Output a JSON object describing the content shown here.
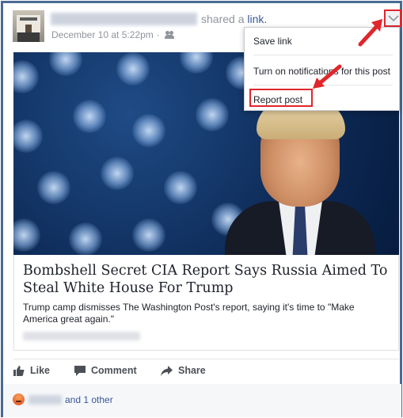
{
  "post": {
    "shared_prefix": "shared a",
    "shared_link": "link.",
    "timestamp": "December 10 at 5:22pm",
    "separator": "·",
    "privacy_icon": "friends-icon",
    "options_icon": "chevron-down-icon"
  },
  "menu": {
    "items": [
      "Save link",
      "Turn on notifications for this post",
      "Report post"
    ]
  },
  "article": {
    "title": "Bombshell Secret CIA Report Says Russia Aimed To Steal White House For Trump",
    "description": "Trump camp dismisses The Washington Post's report, saying it's time to \"Make America great again.\""
  },
  "actions": {
    "like": "Like",
    "comment": "Comment",
    "share": "Share"
  },
  "reactions": {
    "icon": "angry-reaction-icon",
    "others_text": "and 1 other"
  },
  "colors": {
    "highlight": "#e0262b",
    "link": "#365899",
    "frame": "#4a6a93"
  }
}
